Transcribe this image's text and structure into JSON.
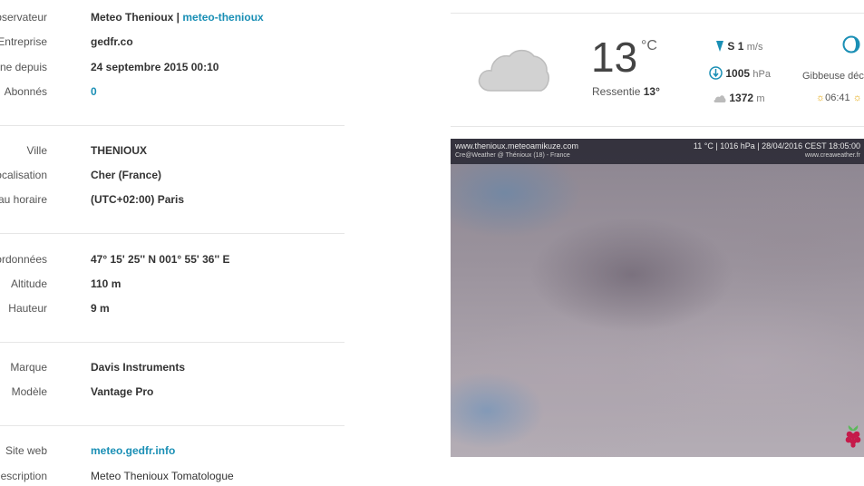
{
  "station": {
    "observer": {
      "label": "Observateur",
      "name": "Meteo Thenioux",
      "separator": " | ",
      "handle": "meteo-thenioux"
    },
    "company": {
      "label": "Entreprise",
      "value": "gedfr.co"
    },
    "online_since": {
      "label": "En ligne depuis",
      "value": "24 septembre 2015 00:10"
    },
    "subscribers": {
      "label": "Abonnés",
      "value": "0"
    },
    "town": {
      "label": "Ville",
      "value": "THENIOUX"
    },
    "location": {
      "label": "Localisation",
      "value": "Cher (France)"
    },
    "timezone": {
      "label": "Fuseau horaire",
      "value": "(UTC+02:00) Paris"
    },
    "coordinates": {
      "label": "Coordonnées",
      "value": "47° 15' 25'' N  001° 55' 36'' E"
    },
    "altitude": {
      "label": "Altitude",
      "value": "110 m"
    },
    "height": {
      "label": "Hauteur",
      "value": "9 m"
    },
    "brand": {
      "label": "Marque",
      "value": "Davis Instruments"
    },
    "model": {
      "label": "Modèle",
      "value": "Vantage Pro"
    },
    "website": {
      "label": "Site web",
      "value": "meteo.gedfr.info"
    },
    "description": {
      "label": "Description",
      "value": "Meteo Thenioux Tomatologue"
    }
  },
  "weather": {
    "condition_icon": "cloud-icon",
    "temperature": "13",
    "temperature_unit": "°C",
    "feels_like_label": "Ressentie",
    "feels_like_value": "13°",
    "wind_dir": "S",
    "wind_speed": "1",
    "wind_unit": "m/s",
    "pressure": "1005",
    "pressure_unit": "hPa",
    "cloud_base": "1372",
    "cloud_base_unit": "m",
    "moon_phase": "Gibbeuse décr",
    "sunrise": "06:41"
  },
  "webcam": {
    "site": "www.thenioux.meteoamikuze.com",
    "credit": "Cre@Weather @ Thénioux (18) - France",
    "reading": "11 °C  |  1016 hPa  |  28/04/2016 CEST 18:05:00",
    "brand_site": "www.creaweather.fr",
    "badge_icon": "raspberry-icon"
  },
  "colors": {
    "link": "#1a8fb5",
    "accent_blue": "#1a8fb5",
    "sun": "#e5a500"
  }
}
